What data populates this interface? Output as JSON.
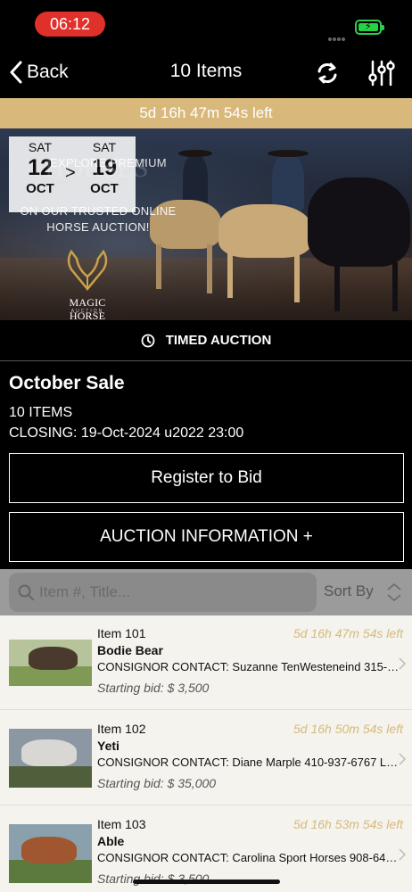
{
  "status_bar": {
    "time": "06:12"
  },
  "nav": {
    "back_label": "Back",
    "title": "10 Items"
  },
  "countdown": "5d 16h 47m 54s left",
  "hero": {
    "start": {
      "dow": "SAT",
      "day": "12",
      "month": "OCT"
    },
    "separator": ">",
    "end": {
      "dow": "SAT",
      "day": "19",
      "month": "OCT"
    },
    "tagline_1": "EXPLORE PREMIUM",
    "tagline_2": "HORSES",
    "tagline_3": "ON OUR TRUSTED ONLINE",
    "tagline_4": "HORSE AUCTION!",
    "brand": "MAGIC HORSE",
    "brand_sub": "AUCTION"
  },
  "auction_type": "TIMED AUCTION",
  "sale": {
    "title": "October Sale",
    "items_count": "10 ITEMS",
    "closing": "CLOSING: 19-Oct-2024 u2022 23:00",
    "register_label": "Register to Bid",
    "info_label": "AUCTION INFORMATION +"
  },
  "search": {
    "placeholder": "Item #, Title...",
    "sort_label": "Sort By"
  },
  "items": [
    {
      "number": "Item 101",
      "time_left": "5d 16h 47m 54s left",
      "name": "Bodie Bear",
      "contact": "CONSIGNOR CONTACT:  Suzanne TenWesteneind 315-25…",
      "bid": "Starting bid: $ 3,500"
    },
    {
      "number": "Item 102",
      "time_left": "5d 16h 50m 54s left",
      "name": "Yeti",
      "contact": "CONSIGNOR CONTACT:  Diane Marple 410-937-6767 LOC…",
      "bid": "Starting bid: $ 35,000"
    },
    {
      "number": "Item 103",
      "time_left": "5d 16h 53m 54s left",
      "name": "Able",
      "contact": "CONSIGNOR CONTACT:  Carolina Sport Horses 908-645-…",
      "bid": "Starting bid: $ 3,500"
    }
  ],
  "colors": {
    "accent_gold": "#d8b97b",
    "time_pill": "#e0302a",
    "battery": "#29d04a"
  }
}
